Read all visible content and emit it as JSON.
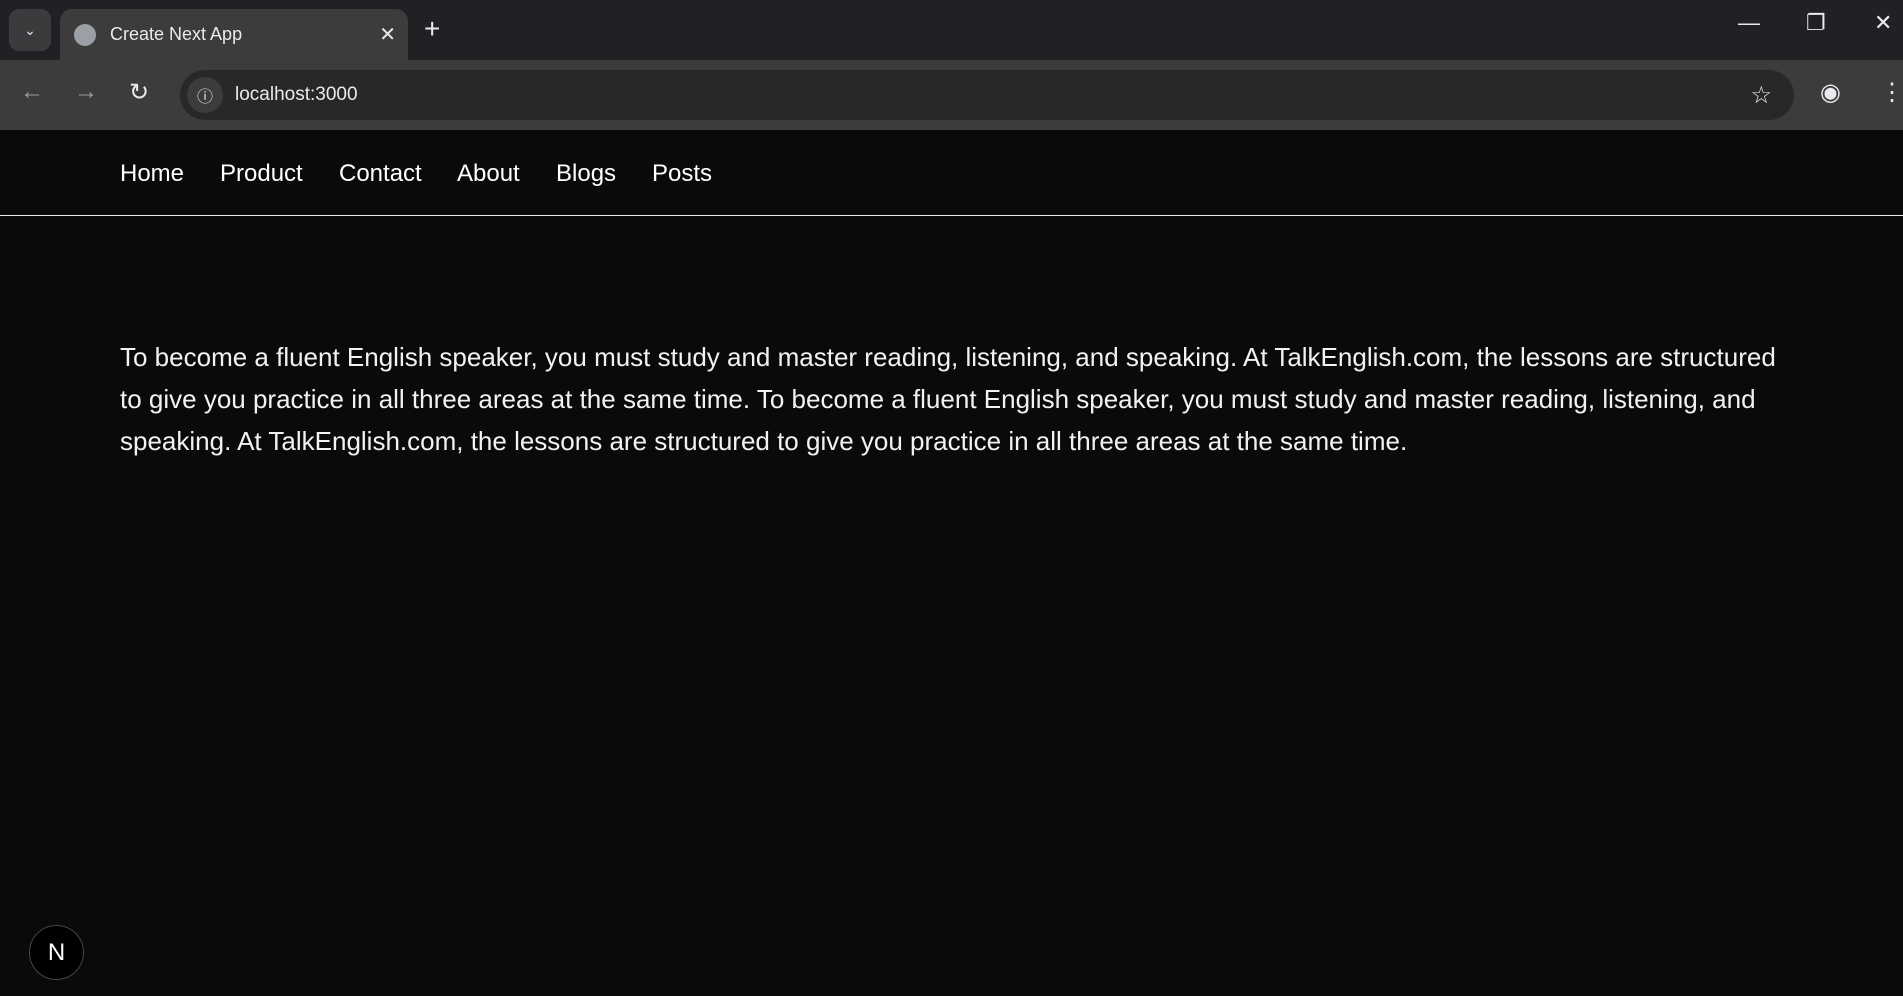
{
  "browser": {
    "tab_title": "Create Next App",
    "url": "localhost:3000"
  },
  "nav": {
    "items": [
      "Home",
      "Product",
      "Contact",
      "About",
      "Blogs",
      "Posts"
    ]
  },
  "main": {
    "paragraph": "To become a fluent English speaker, you must study and master reading, listening, and speaking. At TalkEnglish.com, the lessons are structured to give you practice in all three areas at the same time. To become a fluent English speaker, you must study and master reading, listening, and speaking. At TalkEnglish.com, the lessons are structured to give you practice in all three areas at the same time."
  },
  "devtools": {
    "badge": "N"
  }
}
